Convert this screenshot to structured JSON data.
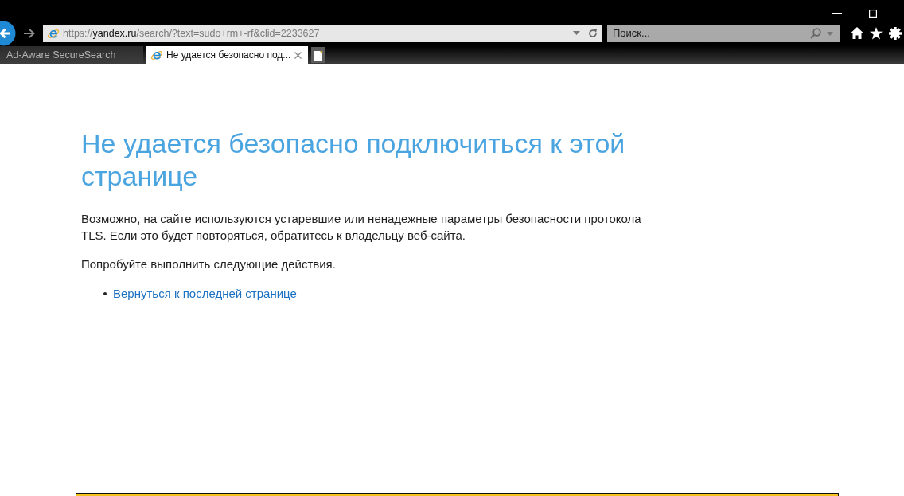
{
  "address_bar": {
    "scheme": "https://",
    "host": "yandex.ru",
    "path": "/search/?text=sudo+rm+-rf&clid=2233627"
  },
  "search": {
    "placeholder": "Поиск..."
  },
  "tabs": [
    {
      "label": "Ad-Aware SecureSearch",
      "selected": false
    },
    {
      "label": "Не удается безопасно под...",
      "selected": true
    }
  ],
  "page": {
    "heading": "Не удается безопасно подключиться к этой странице",
    "paragraphs": [
      "Возможно, на сайте используются устаревшие или ненадежные параметры безопасности протокола TLS. Если это будет повторяться, обратитесь к владельцу веб-сайта.",
      "Попробуйте выполнить следующие действия."
    ],
    "actions": [
      {
        "label": "Вернуться к последней странице"
      }
    ]
  }
}
